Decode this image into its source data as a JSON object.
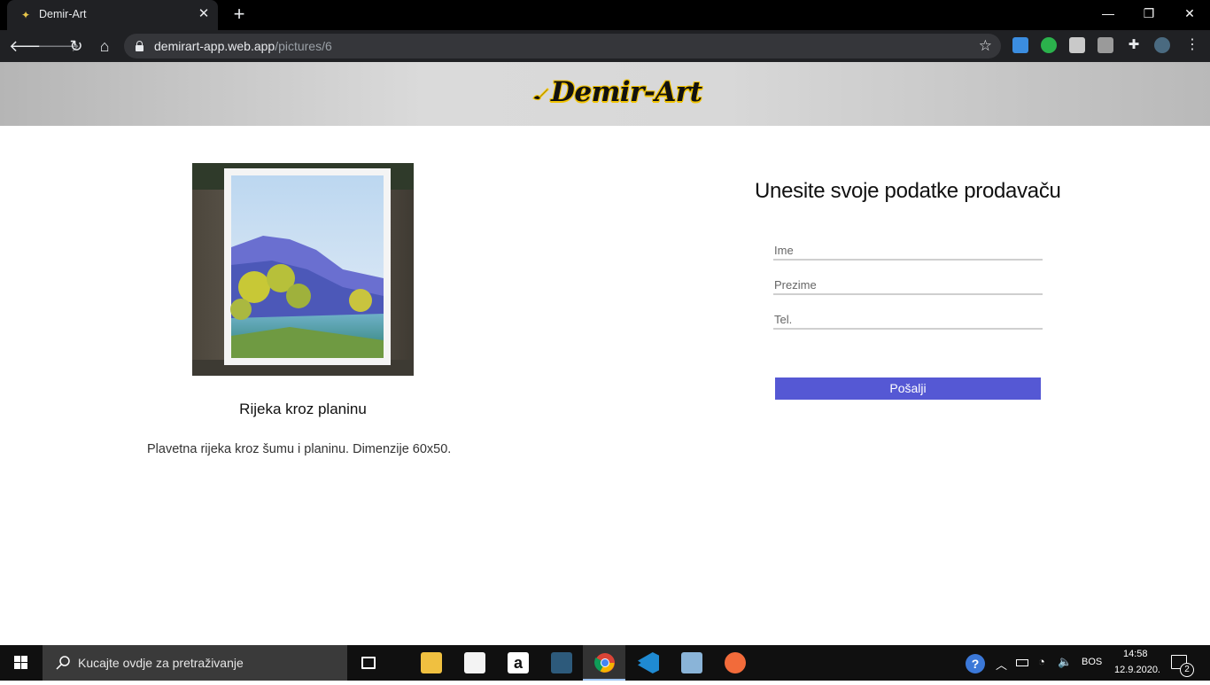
{
  "browser": {
    "tab_title": "Demir-Art",
    "tab_close": "✕",
    "new_tab": "+",
    "url_host": "demirart-app.web.app",
    "url_path": "/pictures/6",
    "win_minimize": "—",
    "win_restore": "❐",
    "win_close": "✕"
  },
  "site": {
    "logo_text": "Demir-Art"
  },
  "picture": {
    "title": "Rijeka kroz planinu",
    "description": "Plavetna rijeka kroz šumu i planinu. Dimenzije 60x50."
  },
  "form": {
    "title": "Unesite svoje podatke prodavaču",
    "first_name_placeholder": "Ime",
    "last_name_placeholder": "Prezime",
    "phone_placeholder": "Tel.",
    "submit_label": "Pošalji"
  },
  "taskbar": {
    "search_placeholder": "Kucajte ovdje za pretraživanje",
    "language": "BOS",
    "time": "14:58",
    "date": "12.9.2020.",
    "notification_count": "2"
  },
  "colors": {
    "accent_button": "#5558d4",
    "logo_outline": "#f2c400",
    "header_gray": "#d5d5d5"
  }
}
